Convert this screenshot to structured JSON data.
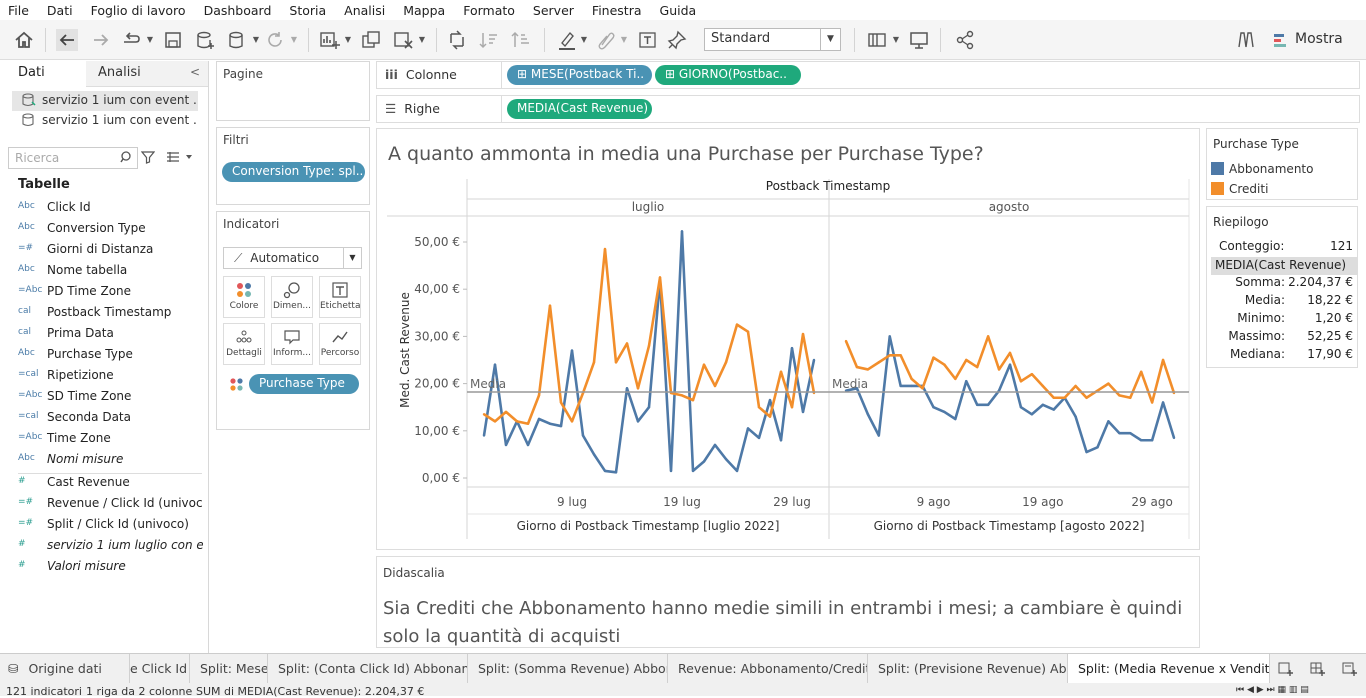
{
  "menu": [
    "File",
    "Dati",
    "Foglio di lavoro",
    "Dashboard",
    "Storia",
    "Analisi",
    "Mappa",
    "Formato",
    "Server",
    "Finestra",
    "Guida"
  ],
  "toolbar": {
    "fit_select": "Standard",
    "show_me": "Mostra"
  },
  "left": {
    "tabs": {
      "data": "Dati",
      "analytics": "Analisi"
    },
    "sources": [
      "servizio 1 ium con event ...",
      "servizio 1 ium con event ..."
    ],
    "search_placeholder": "Ricerca",
    "tables_header": "Tabelle",
    "fields": [
      {
        "type": "Abc",
        "name": "Click Id"
      },
      {
        "type": "Abc",
        "name": "Conversion Type"
      },
      {
        "type": "=#",
        "name": "Giorni di Distanza"
      },
      {
        "type": "Abc",
        "name": "Nome tabella"
      },
      {
        "type": "=Abc",
        "name": "PD Time Zone"
      },
      {
        "type": "cal",
        "name": "Postback Timestamp"
      },
      {
        "type": "cal",
        "name": "Prima Data"
      },
      {
        "type": "Abc",
        "name": "Purchase Type"
      },
      {
        "type": "=cal",
        "name": "Ripetizione"
      },
      {
        "type": "=Abc",
        "name": "SD Time Zone"
      },
      {
        "type": "=cal",
        "name": "Seconda Data"
      },
      {
        "type": "=Abc",
        "name": "Time Zone"
      },
      {
        "type": "Abc",
        "name": "Nomi misure"
      }
    ],
    "measures": [
      {
        "type": "#",
        "name": "Cast Revenue"
      },
      {
        "type": "=#",
        "name": "Revenue / Click Id (univoc..."
      },
      {
        "type": "=#",
        "name": "Split / Click Id (univoco)"
      },
      {
        "type": "#",
        "name": "servizio 1 ium luglio con ev..."
      },
      {
        "type": "#",
        "name": "Valori misure"
      }
    ]
  },
  "cards": {
    "pages": "Pagine",
    "filters": "Filtri",
    "filter_pill": "Conversion Type: spl..",
    "marks": "Indicatori",
    "mark_type": "Automatico",
    "mark_buttons": [
      "Colore",
      "Dimen...",
      "Etichetta",
      "Dettagli",
      "Inform...",
      "Percorso"
    ],
    "marks_pill": "Purchase Type"
  },
  "shelves": {
    "columns_label": "Colonne",
    "rows_label": "Righe",
    "col_pills": [
      "MESE(Postback Ti..",
      "GIORNO(Postbac.."
    ],
    "row_pill": "MEDIA(Cast Revenue)"
  },
  "viz": {
    "title": "A quanto ammonta in media una Purchase per Purchase Type?",
    "header": "Postback Timestamp",
    "panes": [
      "luglio",
      "agosto"
    ],
    "ylabel": "Med. Cast Revenue",
    "yticks": [
      "50,00 €",
      "40,00 €",
      "30,00 €",
      "20,00 €",
      "10,00 €",
      "0,00 €"
    ],
    "xticks_jul": [
      "9 lug",
      "19 lug",
      "29 lug"
    ],
    "xticks_aug": [
      "9 ago",
      "19 ago",
      "29 ago"
    ],
    "xlabel_jul": "Giorno di Postback Timestamp [luglio 2022]",
    "xlabel_aug": "Giorno di Postback Timestamp [agosto 2022]",
    "ref_label": "Media"
  },
  "chart_data": {
    "type": "line",
    "title": "A quanto ammonta in media una Purchase per Purchase Type?",
    "xlabel": "Giorno di Postback Timestamp",
    "ylabel": "Med. Cast Revenue",
    "ylim": [
      0,
      54
    ],
    "reference_line": {
      "label": "Media",
      "value": 18.22
    },
    "panes": [
      {
        "month": "luglio",
        "days": [
          1,
          2,
          3,
          4,
          5,
          6,
          7,
          8,
          9,
          10,
          11,
          12,
          13,
          14,
          15,
          16,
          17,
          18,
          19,
          20,
          21,
          22,
          23,
          24,
          25,
          26,
          27,
          28,
          29,
          30,
          31
        ],
        "series": [
          {
            "name": "Abbonamento",
            "values": [
              9,
              24,
              7,
              12,
              7,
              12.5,
              11.5,
              11,
              27,
              9,
              5,
              1.5,
              1.2,
              19,
              12,
              15,
              42,
              1.5,
              52.25,
              1.5,
              3.5,
              7,
              4,
              1.5,
              10.5,
              8.5,
              16.5,
              8,
              27.5,
              14,
              25
            ]
          },
          {
            "name": "Crediti",
            "values": [
              13.5,
              12,
              14,
              12,
              11.5,
              17.5,
              36.5,
              16,
              12,
              18,
              24.5,
              48.5,
              24.5,
              28.5,
              19,
              28,
              42.5,
              18,
              17.5,
              16.5,
              24,
              19.5,
              24.5,
              32.5,
              31,
              15,
              13,
              22.5,
              15,
              30.5,
              18
            ]
          }
        ]
      },
      {
        "month": "agosto",
        "days": [
          1,
          2,
          3,
          4,
          5,
          6,
          7,
          8,
          9,
          10,
          11,
          12,
          13,
          14,
          15,
          16,
          17,
          18,
          19,
          20,
          21,
          22,
          23,
          24,
          25,
          26,
          27,
          28,
          29,
          30,
          31
        ],
        "series": [
          {
            "name": "Abbonamento",
            "values": [
              18.5,
              19,
              13.5,
              9,
              30,
              19.5,
              19.5,
              19.5,
              15,
              14,
              12.5,
              20.5,
              15.5,
              15.5,
              18.5,
              24,
              15,
              13.5,
              15.5,
              14.5,
              17,
              13,
              5.5,
              6.5,
              12,
              9.5,
              9.5,
              8,
              8,
              16,
              8.5
            ]
          },
          {
            "name": "Crediti",
            "values": [
              29,
              23.5,
              23,
              24.5,
              26,
              26,
              21,
              19,
              25.5,
              24,
              21,
              25,
              23.5,
              30,
              23,
              26.5,
              20.5,
              22,
              19.5,
              17,
              17,
              19.5,
              17,
              18.5,
              20,
              17.5,
              17,
              22.5,
              16,
              25,
              18
            ]
          }
        ]
      }
    ]
  },
  "legend": {
    "title": "Purchase Type",
    "items": [
      {
        "name": "Abbonamento",
        "color": "#4e79a7"
      },
      {
        "name": "Crediti",
        "color": "#f28e2b"
      }
    ]
  },
  "summary": {
    "title": "Riepilogo",
    "count_label": "Conteggio:",
    "count": "121",
    "measure": "MEDIA(Cast Revenue)",
    "rows": [
      {
        "k": "Somma:",
        "v": "2.204,37 €"
      },
      {
        "k": "Media:",
        "v": "18,22 €"
      },
      {
        "k": "Minimo:",
        "v": "1,20 €"
      },
      {
        "k": "Massimo:",
        "v": "52,25 €"
      },
      {
        "k": "Mediana:",
        "v": "17,90 €"
      }
    ]
  },
  "caption": {
    "title": "Didascalia",
    "text": "Sia Crediti che Abbonamento hanno medie simili in entrambi i mesi; a cambiare è quindi solo la quantità di acquisti"
  },
  "sheet_tabs": [
    "Origine dati",
    "e Click Id",
    "Split: Mese",
    "Split: (Conta Click Id) Abbonam...",
    "Split: (Somma Revenue) Abbon...",
    "Revenue: Abbonamento/Credit...",
    "Split: (Previsione Revenue) Abb...",
    "Split: (Media Revenue x Vendit..."
  ],
  "status": {
    "marks": "121 indicatori",
    "rows": "1 riga da 2 colonne",
    "sum": "SUM di MEDIA(Cast Revenue): 2.204,37 €"
  }
}
